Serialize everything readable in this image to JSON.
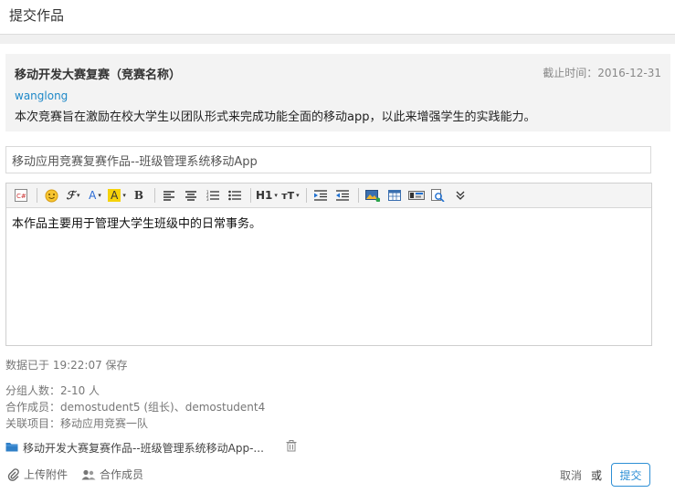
{
  "page": {
    "title": "提交作品"
  },
  "contest": {
    "name": "移动开发大赛复赛（竞赛名称）",
    "deadline": "截止时间：2016-12-31",
    "author": "wanglong",
    "description": "本次竞赛旨在激励在校大学生以团队形式来完成功能全面的移动app，以此来增强学生的实践能力。"
  },
  "form": {
    "title_value": "移动应用竞赛复赛作品--班级管理系统移动App",
    "editor_content": "本作品主要用于管理大学生班级中的日常事务。",
    "toolbar": {
      "font_label": "A",
      "highlight_label": "A",
      "bold_label": "B",
      "heading_label": "H1",
      "size_label": "тT"
    }
  },
  "status": {
    "saved": "数据已于 19:22:07 保存"
  },
  "group": {
    "size": "分组人数：2-10 人",
    "members": "合作成员：demostudent5 (组长)、demostudent4",
    "project": "关联项目：移动应用竞赛一队"
  },
  "attachment": {
    "filename": "移动开发大赛复赛作品--班级管理系统移动App-..."
  },
  "actions": {
    "upload": "上传附件",
    "members": "合作成员",
    "cancel": "取消",
    "or": "或",
    "submit": "提交"
  },
  "colors": {
    "accent": "#2d8fd5",
    "link": "#1e88c8"
  }
}
